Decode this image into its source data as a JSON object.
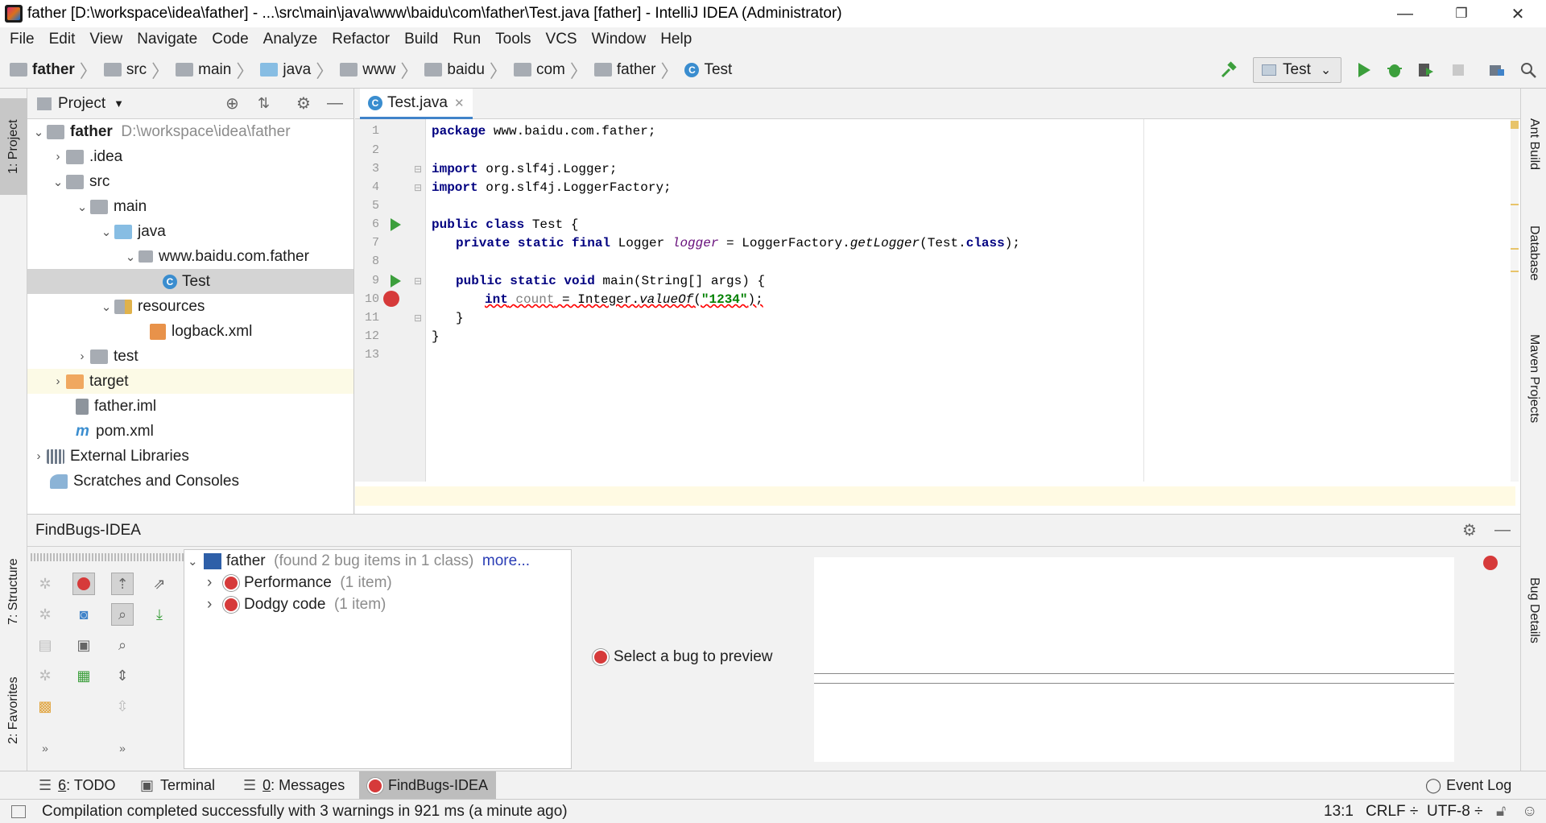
{
  "window": {
    "title": "father [D:\\workspace\\idea\\father] - ...\\src\\main\\java\\www\\baidu\\com\\father\\Test.java [father] - IntelliJ IDEA (Administrator)",
    "minimize": "—",
    "restore": "❐",
    "close": "✕"
  },
  "menu": [
    "File",
    "Edit",
    "View",
    "Navigate",
    "Code",
    "Analyze",
    "Refactor",
    "Build",
    "Run",
    "Tools",
    "VCS",
    "Window",
    "Help"
  ],
  "breadcrumb": [
    "father",
    "src",
    "main",
    "java",
    "www",
    "baidu",
    "com",
    "father",
    "Test"
  ],
  "toolbar": {
    "run_config": "Test",
    "dropdown": "⌄"
  },
  "left_strip": {
    "project_tab": "1: Project",
    "structure_tab": "7: Structure",
    "favorites_tab": "2: Favorites"
  },
  "right_strip": {
    "ant": "Ant Build",
    "database": "Database",
    "maven": "Maven Projects",
    "bug_details": "Bug Details"
  },
  "project": {
    "header": "Project",
    "tree": [
      {
        "label": "father",
        "extra": "D:\\workspace\\idea\\father",
        "bold": true
      },
      {
        "label": ".idea"
      },
      {
        "label": "src"
      },
      {
        "label": "main"
      },
      {
        "label": "java"
      },
      {
        "label": "www.baidu.com.father"
      },
      {
        "label": "Test"
      },
      {
        "label": "resources"
      },
      {
        "label": "logback.xml"
      },
      {
        "label": "test"
      },
      {
        "label": "target"
      },
      {
        "label": "father.iml"
      },
      {
        "label": "pom.xml"
      },
      {
        "label": "External Libraries"
      },
      {
        "label": "Scratches and Consoles"
      }
    ]
  },
  "editor": {
    "tab": "Test.java",
    "line_numbers": [
      "1",
      "2",
      "3",
      "4",
      "5",
      "6",
      "7",
      "8",
      "9",
      "10",
      "11",
      "12",
      "13"
    ],
    "code": {
      "l1_kw": "package",
      "l1_rest": " www.baidu.com.father;",
      "l3_kw": "import",
      "l3_rest": " org.slf4j.Logger;",
      "l4_kw": "import",
      "l4_rest": " org.slf4j.LoggerFactory;",
      "l6_kw": "public class",
      "l6_rest": " Test {",
      "l7_kw": "private static final",
      "l7_a": " Logger ",
      "l7_fld": "logger",
      "l7_b": " = LoggerFactory.",
      "l7_it": "getLogger",
      "l7_c": "(Test.",
      "l7_kw2": "class",
      "l7_d": ");",
      "l9_kw": "public static void",
      "l9_rest": " main(String[] args) {",
      "l10_kw": "int",
      "l10_unused": "count",
      "l10_a": " = Integer.",
      "l10_it": "valueOf",
      "l10_b": "(",
      "l10_str": "\"1234\"",
      "l10_c": ");",
      "l11": "}",
      "l12": "}"
    }
  },
  "findbugs": {
    "title": "FindBugs-IDEA",
    "root": "father",
    "root_info": "(found 2 bug items in 1 class)",
    "more": "more...",
    "items": [
      {
        "label": "Performance",
        "count": "(1 item)"
      },
      {
        "label": "Dodgy code",
        "count": "(1 item)"
      }
    ],
    "preview": "Select a bug to preview"
  },
  "tool_tabs": [
    {
      "num": "6",
      "label": ": TODO"
    },
    {
      "label": "Terminal"
    },
    {
      "num": "0",
      "label": ": Messages"
    },
    {
      "label": "FindBugs-IDEA"
    }
  ],
  "event_log": "Event Log",
  "status": {
    "message": "Compilation completed successfully with 3 warnings in 921 ms (a minute ago)",
    "position": "13:1",
    "line_sep": "CRLF ÷",
    "encoding": "UTF-8 ÷"
  },
  "colors": {
    "accent": "#4083c9",
    "run_green": "#3c9f3c",
    "bug_red": "#d63a3a",
    "current_line": "#fffae3",
    "selected_row": "#d4d4d4"
  }
}
